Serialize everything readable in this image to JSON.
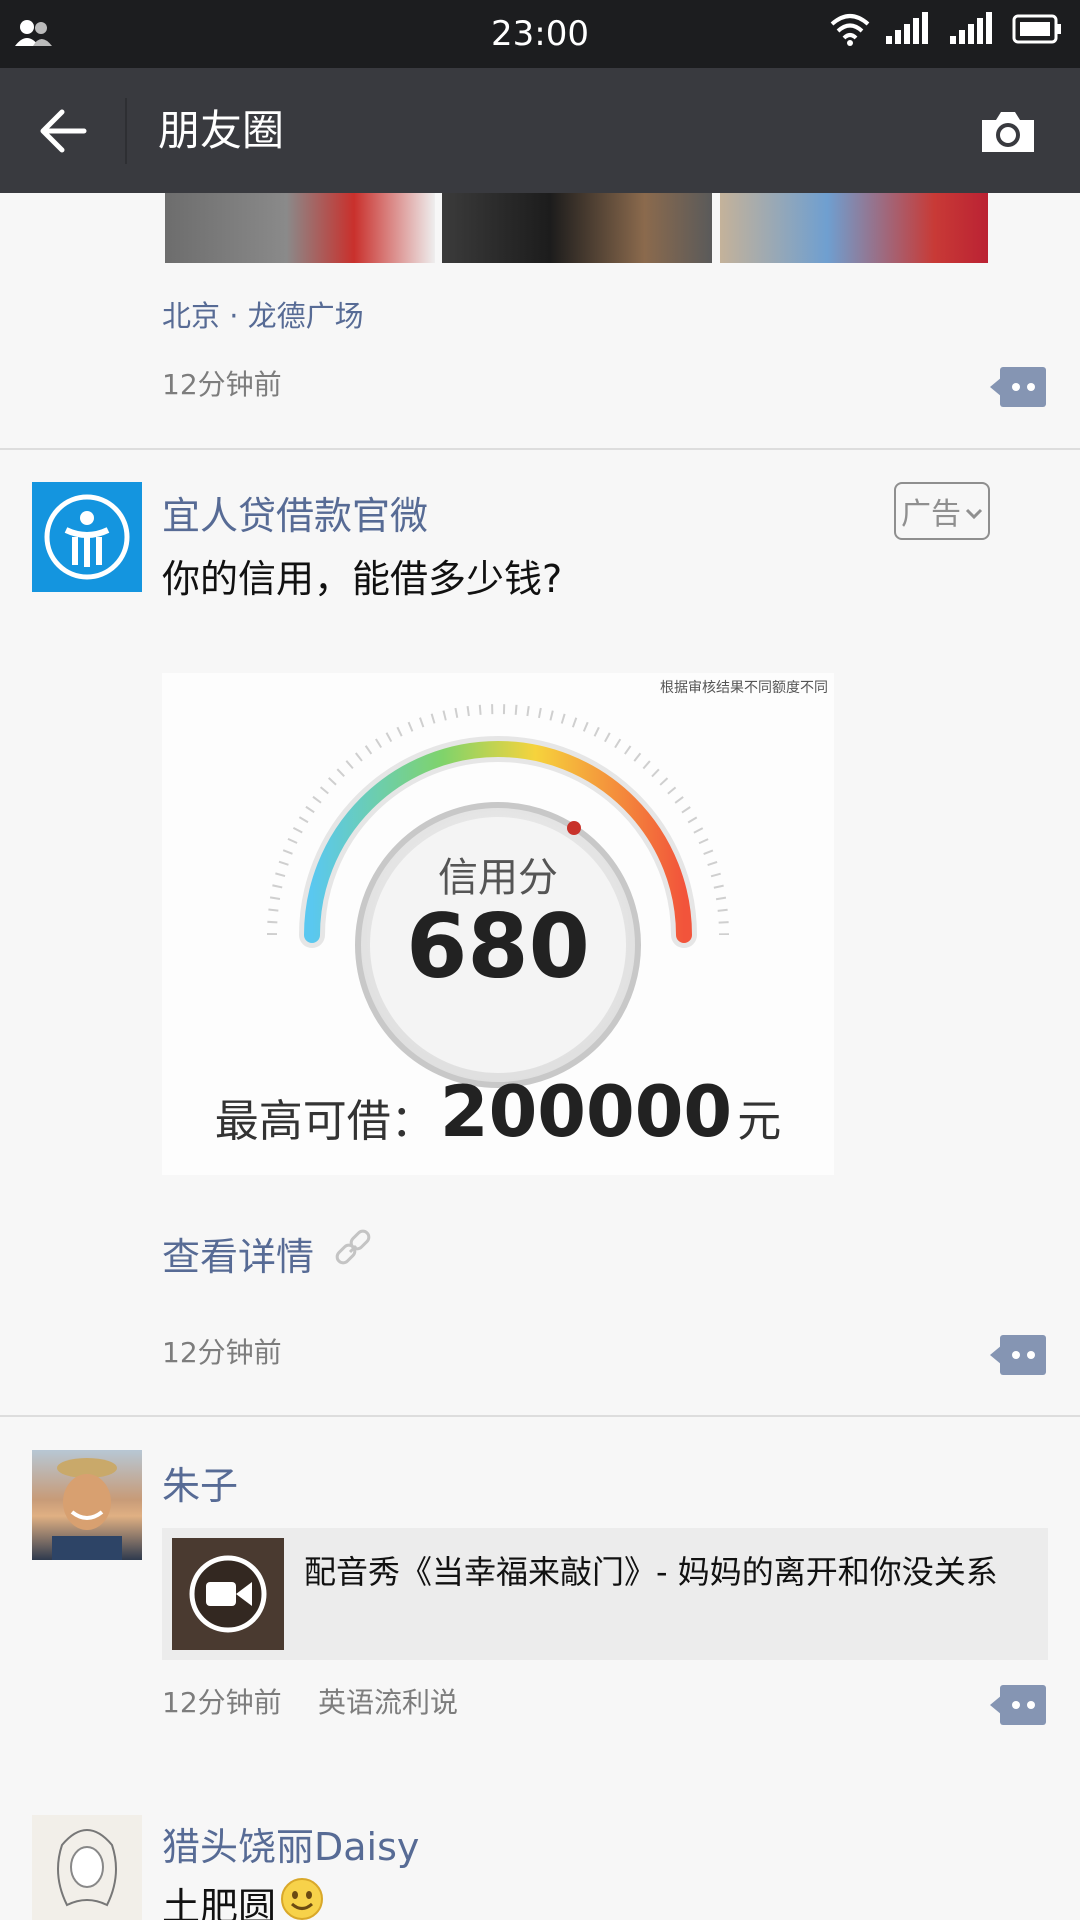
{
  "status_bar": {
    "time": "23:00"
  },
  "nav": {
    "title": "朋友圈"
  },
  "post1": {
    "location": "北京 · 龙德广场",
    "time": "12分钟前"
  },
  "ad_post": {
    "author": "宜人贷借款官微",
    "text": "你的信用，能借多少钱?",
    "badge": "广告",
    "image": {
      "disclaimer": "根据审核结果不同额度不同",
      "score_label": "信用分",
      "score_value": "680",
      "max_label": "最高可借：",
      "max_amount": "200000",
      "max_unit": "元"
    },
    "detail_link": "查看详情",
    "time": "12分钟前"
  },
  "post3": {
    "author": "朱子",
    "share_title": "配音秀《当幸福来敲门》- 妈妈的离开和你没关系",
    "time": "12分钟前",
    "source": "英语流利说"
  },
  "post4": {
    "author": "猎头饶丽Daisy",
    "text": "土肥圆"
  },
  "colors": {
    "status_bar": "#1c1d1f",
    "nav_bar": "#393a3f",
    "link_blue": "#576b95",
    "background": "#f7f7f7"
  },
  "icons": [
    "contacts-icon",
    "wifi-icon",
    "signal-icon",
    "battery-icon",
    "back-arrow-icon",
    "camera-icon",
    "comment-icon",
    "link-icon",
    "video-play-icon",
    "smile-emoji-icon"
  ]
}
